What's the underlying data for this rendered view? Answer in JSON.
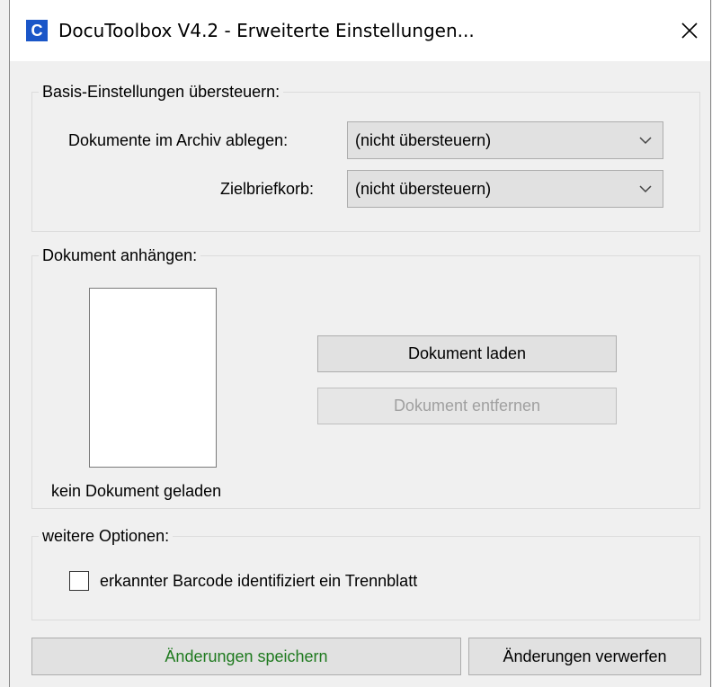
{
  "window": {
    "title": "DocuToolbox V4.2 - Erweiterte Einstellungen...",
    "app_icon_letter": "C",
    "close_icon": "close-icon"
  },
  "basis": {
    "legend": "Basis-Einstellungen übersteuern:",
    "archive_label": "Dokumente im Archiv ablegen:",
    "archive_value": "(nicht übersteuern)",
    "tray_label": "Zielbriefkorb:",
    "tray_value": "(nicht übersteuern)"
  },
  "attach": {
    "legend": "Dokument anhängen:",
    "status": "kein Dokument geladen",
    "load_button": "Dokument laden",
    "remove_button": "Dokument entfernen",
    "remove_enabled": false
  },
  "options": {
    "legend": "weitere Optionen:",
    "barcode_label": "erkannter Barcode identifiziert ein Trennblatt",
    "barcode_checked": false
  },
  "footer": {
    "save_button": "Änderungen speichern",
    "discard_button": "Änderungen verwerfen"
  }
}
